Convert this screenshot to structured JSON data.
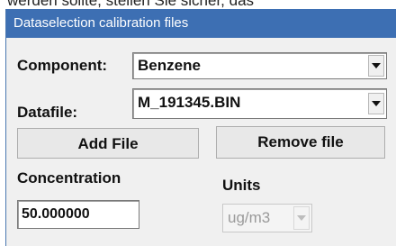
{
  "background_text": "werden sollte, stellen Sie sicher, das",
  "window": {
    "title": "Dataselection calibration files"
  },
  "component": {
    "label": "Component:",
    "value": "Benzene"
  },
  "datafile": {
    "label": "Datafile:",
    "value": "M_191345.BIN"
  },
  "buttons": {
    "add_file": "Add File",
    "remove_file": "Remove file"
  },
  "concentration": {
    "label": "Concentration",
    "value": "50.000000"
  },
  "units": {
    "label": "Units",
    "value": "ug/m3"
  },
  "icons": {
    "dropdown": "chevron-down-icon"
  },
  "colors": {
    "titlebar": "#3d6fb3",
    "dialog_bg": "#f0f0f0"
  }
}
